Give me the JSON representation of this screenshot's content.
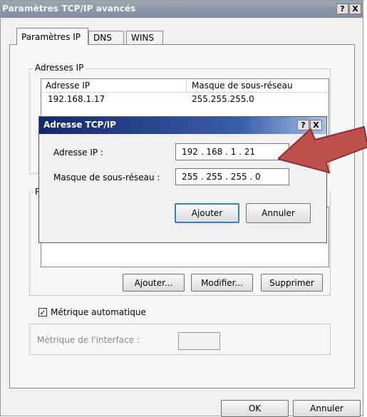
{
  "window": {
    "title": "Paramètres TCP/IP avancés",
    "help_label": "?",
    "close_label": "X"
  },
  "tabs": [
    {
      "label": "Paramètres IP"
    },
    {
      "label": "DNS"
    },
    {
      "label": "WINS"
    }
  ],
  "ip_group": {
    "label": "Adresses IP",
    "columns": [
      "Adresse IP",
      "Masque de sous-réseau"
    ],
    "rows": [
      {
        "ip": "192.168.1.17",
        "mask": "255.255.255.0"
      }
    ]
  },
  "gateway_group": {
    "label_partial": "P"
  },
  "buttons": {
    "add": "Ajouter...",
    "modify": "Modifier...",
    "remove": "Supprimer"
  },
  "metric": {
    "checkbox_label": "Métrique automatique",
    "checked": true,
    "interface_label": "Métrique de l'interface :",
    "interface_value": ""
  },
  "footer": {
    "ok": "OK",
    "cancel": "Annuler"
  },
  "dialog": {
    "title": "Adresse TCP/IP",
    "help_label": "?",
    "close_label": "X",
    "ip_label": "Adresse IP :",
    "ip_value": "192 . 168 .  1  . 21",
    "mask_label": "Masque de sous-réseau :",
    "mask_value": "255 . 255 . 255 .  0",
    "add": "Ajouter",
    "cancel": "Annuler"
  },
  "annotation": {
    "arrow_color": "#c0504d"
  }
}
